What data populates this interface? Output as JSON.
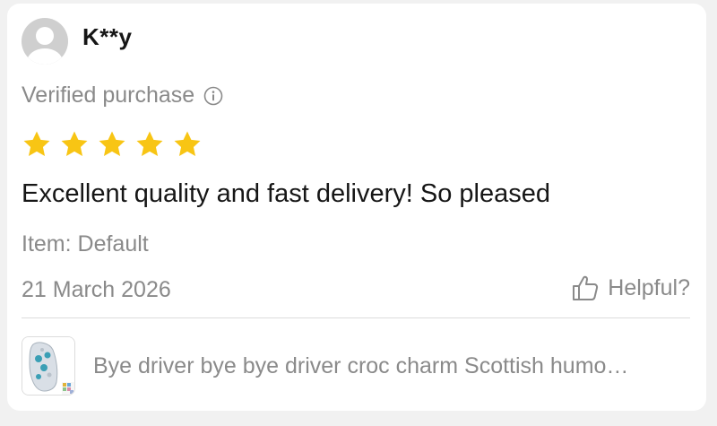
{
  "reviewer": {
    "name": "K**y",
    "avatar_icon": "user-avatar-icon"
  },
  "verified": {
    "label": "Verified purchase",
    "icon": "info-icon"
  },
  "rating": {
    "value": 5,
    "max": 5,
    "star_color": "#F8C514"
  },
  "review": {
    "text": "Excellent quality and fast delivery! So pleased",
    "item_variant": "Item: Default",
    "date": "21 March 2026"
  },
  "helpful": {
    "label": "Helpful?",
    "icon": "thumbs-up-icon"
  },
  "product": {
    "title": "Bye driver bye bye driver croc charm Scottish humo…",
    "thumbnail_icon": "croc-charm-thumbnail"
  }
}
